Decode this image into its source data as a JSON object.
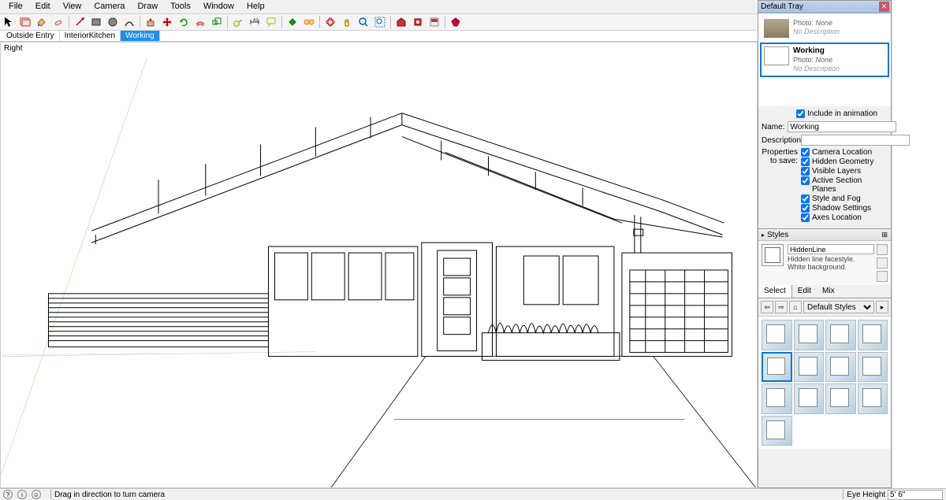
{
  "menu": [
    "File",
    "Edit",
    "View",
    "Camera",
    "Draw",
    "Tools",
    "Window",
    "Help"
  ],
  "tabs": [
    {
      "label": "Outside Entry",
      "active": false
    },
    {
      "label": "InteriorKitchen",
      "active": false
    },
    {
      "label": "Working",
      "active": true
    }
  ],
  "view_label": "Right",
  "tray": {
    "title": "Default Tray",
    "scenes": [
      {
        "name": "",
        "photo": "None",
        "desc": "No Description",
        "selected": false,
        "line": false
      },
      {
        "name": "Working",
        "photo": "None",
        "desc": "No Description",
        "selected": true,
        "line": true
      }
    ],
    "include_anim": true,
    "name_field": "Working",
    "description_field": "",
    "props_label": "Properties to save:",
    "props": [
      {
        "label": "Camera Location",
        "checked": true
      },
      {
        "label": "Hidden Geometry",
        "checked": true
      },
      {
        "label": "Visible Layers",
        "checked": true
      },
      {
        "label": "Active Section Planes",
        "checked": true
      },
      {
        "label": "Style and Fog",
        "checked": true
      },
      {
        "label": "Shadow Settings",
        "checked": true
      },
      {
        "label": "Axes Location",
        "checked": true
      }
    ],
    "labels": {
      "include": "Include in animation",
      "name": "Name:",
      "desc": "Description:"
    }
  },
  "styles": {
    "panel_title": "Styles",
    "name": "HiddenLine",
    "desc": "Hidden line facestyle. White background.",
    "tabs": [
      "Select",
      "Edit",
      "Mix"
    ],
    "collection": "Default Styles"
  },
  "status": {
    "hint": "Drag in direction to turn camera",
    "eye_label": "Eye Height",
    "eye_value": "5' 6\""
  }
}
